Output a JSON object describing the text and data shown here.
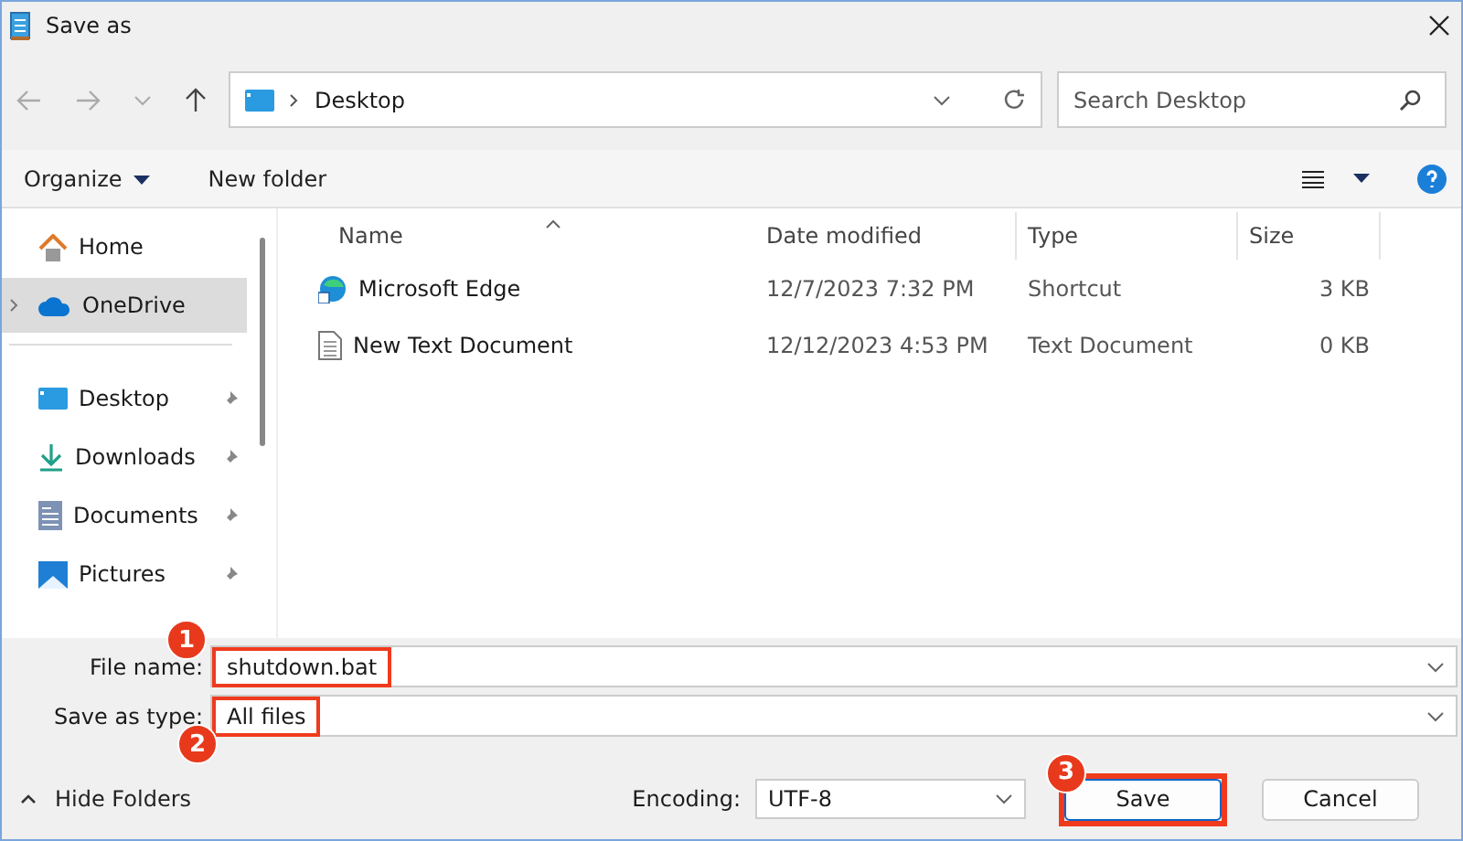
{
  "window": {
    "title": "Save as"
  },
  "address": {
    "path": "Desktop",
    "search_placeholder": "Search Desktop"
  },
  "toolbar": {
    "organize": "Organize",
    "new_folder": "New folder"
  },
  "sidebar": {
    "items": [
      {
        "kind": "item",
        "label": "Home",
        "selected": false,
        "pinned": false,
        "expandable": false
      },
      {
        "kind": "item",
        "label": "OneDrive",
        "selected": true,
        "pinned": false,
        "expandable": true
      },
      {
        "kind": "divider"
      },
      {
        "kind": "item",
        "label": "Desktop",
        "selected": false,
        "pinned": true,
        "expandable": false
      },
      {
        "kind": "item",
        "label": "Downloads",
        "selected": false,
        "pinned": true,
        "expandable": false
      },
      {
        "kind": "item",
        "label": "Documents",
        "selected": false,
        "pinned": true,
        "expandable": false
      },
      {
        "kind": "item",
        "label": "Pictures",
        "selected": false,
        "pinned": true,
        "expandable": false
      }
    ]
  },
  "table": {
    "columns": [
      "Name",
      "Date modified",
      "Type",
      "Size"
    ],
    "rows": [
      {
        "name": "Microsoft Edge",
        "date": "12/7/2023 7:32 PM",
        "type": "Shortcut",
        "size": "3 KB"
      },
      {
        "name": "New Text Document",
        "date": "12/12/2023 4:53 PM",
        "type": "Text Document",
        "size": "0 KB"
      }
    ]
  },
  "form": {
    "file_name": {
      "label": "File name:",
      "value": "shutdown.bat",
      "callout": "1"
    },
    "save_as_type": {
      "label": "Save as type:",
      "value": "All files",
      "callout": "2"
    }
  },
  "footer": {
    "hide_folders": "Hide Folders",
    "encoding_label": "Encoding:",
    "encoding": "UTF-8",
    "buttons": [
      {
        "label": "Save",
        "primary": true,
        "callout": "3"
      },
      {
        "label": "Cancel",
        "primary": false
      }
    ]
  }
}
